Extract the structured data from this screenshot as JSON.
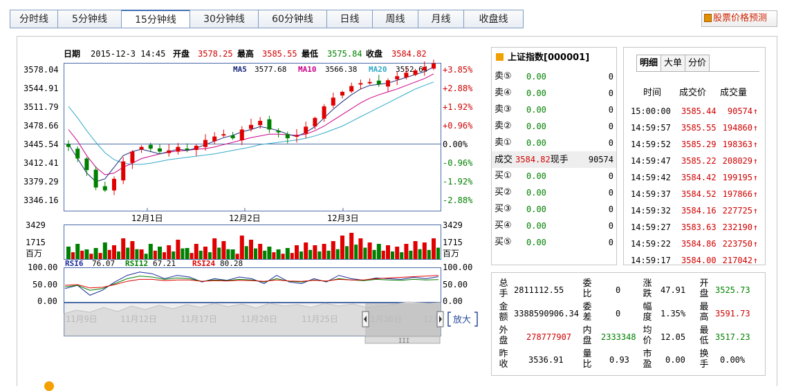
{
  "tabs": [
    "分时线",
    "5分钟线",
    "15分钟线",
    "30分钟线",
    "60分钟线",
    "日线",
    "周线",
    "月线",
    "收盘线"
  ],
  "active_tab": "15分钟线",
  "predict_button": "股票价格预测",
  "kline_header": {
    "date_label": "日期",
    "date_value": "2015-12-3 14:45",
    "open_label": "开盘",
    "open_value": "3578.25",
    "high_label": "最高",
    "high_value": "3585.55",
    "low_label": "最低",
    "low_value": "3575.84",
    "close_label": "收盘",
    "close_value": "3584.82"
  },
  "ma_legend": {
    "ma5_label": "MA5",
    "ma5_value": "3577.68",
    "ma10_label": "MA10",
    "ma10_value": "3566.38",
    "ma20_label": "MA20",
    "ma20_value": "3552.64"
  },
  "price_axis": [
    "3578.04",
    "3544.91",
    "3511.79",
    "3478.66",
    "3445.54",
    "3412.41",
    "3379.29",
    "3346.16"
  ],
  "pct_axis": [
    "+3.85%",
    "+2.88%",
    "+1.92%",
    "+0.96%",
    "0.00%",
    "-0.96%",
    "-1.92%",
    "-2.88%"
  ],
  "date_axis": [
    "12月1日",
    "12月2日",
    "12月3日"
  ],
  "volume_axis": {
    "top": "3429",
    "mid": "1715",
    "unit": "百万"
  },
  "rsi_legend": {
    "rsi6_label": "RSI6",
    "rsi6_value": "76.07",
    "rsi12_label": "RSI12",
    "rsi12_value": "67.21",
    "rsi24_label": "RSI24",
    "rsi24_value": "80.28"
  },
  "rsi_axis": [
    "100.00",
    "50.00",
    "0.00"
  ],
  "navigator": {
    "dates": [
      "11月9日",
      "11月12日",
      "11月17日",
      "11月20日",
      "11月25日",
      "11月30日",
      "12月"
    ],
    "zoom_label": "放大"
  },
  "colors": {
    "up": "#e00000",
    "down": "#008000",
    "ma5": "#1a2a7a",
    "ma10": "#cc0088",
    "ma20": "#30a8c8",
    "rsi6": "#1a2a9a",
    "rsi12": "#008000",
    "rsi24": "#e00000"
  },
  "chart_data": [
    {
      "type": "candlestick",
      "title": "",
      "x": [
        "11-30",
        "12-1",
        "12-2",
        "12-3"
      ],
      "ylim": [
        3330,
        3585
      ],
      "ma5": [
        3445,
        3420,
        3395,
        3380,
        3385,
        3405,
        3425,
        3432,
        3436,
        3432,
        3428,
        3432,
        3436,
        3434,
        3438,
        3444,
        3450,
        3456,
        3460,
        3466,
        3470,
        3475,
        3472,
        3468,
        3462,
        3458,
        3465,
        3475,
        3490,
        3505,
        3518,
        3530,
        3540,
        3546,
        3548,
        3550,
        3555,
        3560,
        3565,
        3570,
        3578
      ],
      "ma10": [
        3470,
        3450,
        3425,
        3405,
        3392,
        3395,
        3405,
        3412,
        3420,
        3424,
        3428,
        3431,
        3433,
        3434,
        3436,
        3437,
        3440,
        3444,
        3448,
        3452,
        3456,
        3459,
        3462,
        3462,
        3461,
        3460,
        3462,
        3468,
        3476,
        3486,
        3496,
        3506,
        3516,
        3524,
        3530,
        3535,
        3540,
        3546,
        3552,
        3558,
        3566
      ],
      "ma20": [
        3510,
        3490,
        3468,
        3448,
        3430,
        3418,
        3412,
        3410,
        3410,
        3412,
        3415,
        3418,
        3420,
        3422,
        3424,
        3426,
        3428,
        3431,
        3434,
        3437,
        3440,
        3444,
        3446,
        3448,
        3450,
        3452,
        3455,
        3459,
        3464,
        3470,
        3476,
        3484,
        3492,
        3500,
        3508,
        3516,
        3524,
        3532,
        3540,
        3546,
        3552
      ]
    },
    {
      "type": "bar",
      "title": "",
      "ylabel": "百万",
      "ylim": [
        0,
        3429
      ]
    },
    {
      "type": "line",
      "title": "",
      "ylim": [
        0,
        100
      ],
      "series": [
        {
          "name": "RSI6",
          "values": [
            40,
            50,
            20,
            35,
            60,
            80,
            90,
            85,
            70,
            80,
            75,
            60,
            70,
            65,
            75,
            70,
            55,
            80,
            60,
            55,
            70,
            60,
            80,
            70,
            65,
            72,
            70,
            68,
            74,
            70,
            76
          ]
        },
        {
          "name": "RSI12",
          "values": [
            45,
            50,
            35,
            40,
            55,
            70,
            78,
            75,
            68,
            72,
            70,
            62,
            66,
            64,
            68,
            66,
            60,
            70,
            62,
            60,
            66,
            62,
            70,
            66,
            64,
            68,
            66,
            65,
            68,
            66,
            67
          ]
        },
        {
          "name": "RSI24",
          "values": [
            50,
            52,
            42,
            44,
            52,
            62,
            68,
            68,
            64,
            66,
            66,
            62,
            64,
            63,
            65,
            64,
            62,
            66,
            63,
            62,
            65,
            63,
            68,
            66,
            66,
            70,
            72,
            74,
            76,
            78,
            80
          ]
        }
      ]
    }
  ],
  "quote5": {
    "title": "上证指数[000001]",
    "rows": [
      {
        "label": "卖⑤",
        "price": "0.00",
        "vol": "0"
      },
      {
        "label": "卖④",
        "price": "0.00",
        "vol": "0"
      },
      {
        "label": "卖③",
        "price": "0.00",
        "vol": "0"
      },
      {
        "label": "卖②",
        "price": "0.00",
        "vol": "0"
      },
      {
        "label": "卖①",
        "price": "0.00",
        "vol": "0"
      }
    ],
    "deal": {
      "label": "成交",
      "price": "3584.82",
      "hand_label": "现手",
      "hand": "90574"
    },
    "buy_rows": [
      {
        "label": "买①",
        "price": "0.00",
        "vol": "0"
      },
      {
        "label": "买②",
        "price": "0.00",
        "vol": "0"
      },
      {
        "label": "买③",
        "price": "0.00",
        "vol": "0"
      },
      {
        "label": "买④",
        "price": "0.00",
        "vol": "0"
      },
      {
        "label": "买⑤",
        "price": "0.00",
        "vol": "0"
      }
    ]
  },
  "ticks": {
    "tabs": [
      "明细",
      "大单",
      "分价"
    ],
    "headers": [
      "时间",
      "成交价",
      "成交量"
    ],
    "rows": [
      {
        "time": "15:00:00",
        "price": "3585.44",
        "vol": "90574"
      },
      {
        "time": "14:59:57",
        "price": "3585.55",
        "vol": "194860"
      },
      {
        "time": "14:59:52",
        "price": "3585.29",
        "vol": "198363"
      },
      {
        "time": "14:59:47",
        "price": "3585.22",
        "vol": "208029"
      },
      {
        "time": "14:59:42",
        "price": "3584.42",
        "vol": "199195"
      },
      {
        "time": "14:59:37",
        "price": "3584.52",
        "vol": "197866"
      },
      {
        "time": "14:59:32",
        "price": "3584.16",
        "vol": "227725"
      },
      {
        "time": "14:59:27",
        "price": "3583.63",
        "vol": "232190"
      },
      {
        "time": "14:59:22",
        "price": "3584.86",
        "vol": "223750"
      },
      {
        "time": "14:59:17",
        "price": "3584.00",
        "vol": "217042"
      }
    ]
  },
  "stats": {
    "total_hands_label": "总手",
    "total_hands": "2811112.55",
    "bid_ratio_label": "委比",
    "bid_ratio": "0",
    "change_label": "涨跌",
    "change": "47.91",
    "open_label": "开盘",
    "open": "3525.73",
    "amount_label": "金额",
    "amount": "3388590906.34",
    "bid_diff_label": "委差",
    "bid_diff": "0",
    "change_pct_label": "幅度",
    "change_pct": "1.35%",
    "high_label": "最高",
    "high": "3591.73",
    "outer_label": "外盘",
    "outer": "278777907",
    "inner_label": "内盘",
    "inner": "2333348",
    "avg_label": "均价",
    "avg": "12.05",
    "low_label": "最低",
    "low": "3517.23",
    "prev_close_label": "昨收",
    "prev_close": "3536.91",
    "vol_ratio_label": "量比",
    "vol_ratio": "0.93",
    "pe_label": "市盈",
    "pe": "0.00",
    "turnover_label": "换手",
    "turnover": "0.00%"
  }
}
